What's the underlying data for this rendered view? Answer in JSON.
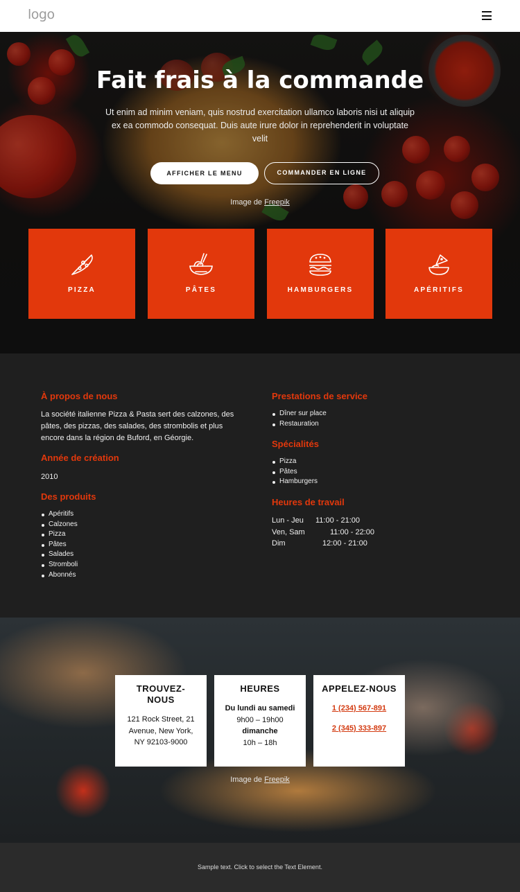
{
  "header": {
    "logo": "logo"
  },
  "hero": {
    "title": "Fait frais à la commande",
    "text": "Ut enim ad minim veniam, quis nostrud exercitation ullamco laboris nisi ut aliquip ex ea commodo consequat. Duis aute irure dolor in reprehenderit in voluptate velit",
    "btn_menu": "AFFICHER LE MENU",
    "btn_order": "COMMANDER EN LIGNE",
    "credit_prefix": "Image de ",
    "credit_link": "Freepik",
    "categories": [
      {
        "label": "PIZZA",
        "icon": "pizza-slice-icon"
      },
      {
        "label": "PÂTES",
        "icon": "pasta-bowl-icon"
      },
      {
        "label": "HAMBURGERS",
        "icon": "burger-icon"
      },
      {
        "label": "APÉRITIFS",
        "icon": "snack-bowl-icon"
      }
    ],
    "accent": "#e2380c"
  },
  "info": {
    "about_title": "À propos de nous",
    "about_text": "La société italienne Pizza & Pasta sert des calzones, des pâtes, des pizzas, des salades, des strombolis et plus encore dans la région de Buford, en Géorgie.",
    "founded_title": "Année de création",
    "founded_value": "2010",
    "products_title": "Des produits",
    "products": [
      "Apéritifs",
      "Calzones",
      "Pizza",
      "Pâtes",
      "Salades",
      "Stromboli",
      "Abonnés"
    ],
    "services_title": "Prestations de service",
    "services": [
      "Dîner sur place",
      "Restauration"
    ],
    "specialties_title": "Spécialités",
    "specialties": [
      "Pizza",
      "Pâtes",
      "Hamburgers"
    ],
    "hours_title": "Heures de travail",
    "hours": [
      {
        "day": "Lun - Jeu",
        "time": "11:00 - 21:00"
      },
      {
        "day": "Ven, Sam",
        "time": "11:00 - 22:00"
      },
      {
        "day": "Dim",
        "time": "12:00 - 21:00"
      }
    ]
  },
  "contact": {
    "find_title": "TROUVEZ-NOUS",
    "address_line1": "121 Rock Street, 21",
    "address_line2": "Avenue, New York,",
    "address_line3": "NY 92103-9000",
    "hours_title": "HEURES",
    "weekday_label": "Du lundi au samedi",
    "weekday_hours": "9h00 – 19h00",
    "sunday_label": "dimanche",
    "sunday_hours": "10h – 18h",
    "call_title": "APPELEZ-NOUS",
    "phone1": "1 (234) 567-891",
    "phone2": "2 (345) 333-897",
    "credit_prefix": "Image de ",
    "credit_link": "Freepik"
  },
  "footer": {
    "text": "Sample text. Click to select the Text Element."
  }
}
